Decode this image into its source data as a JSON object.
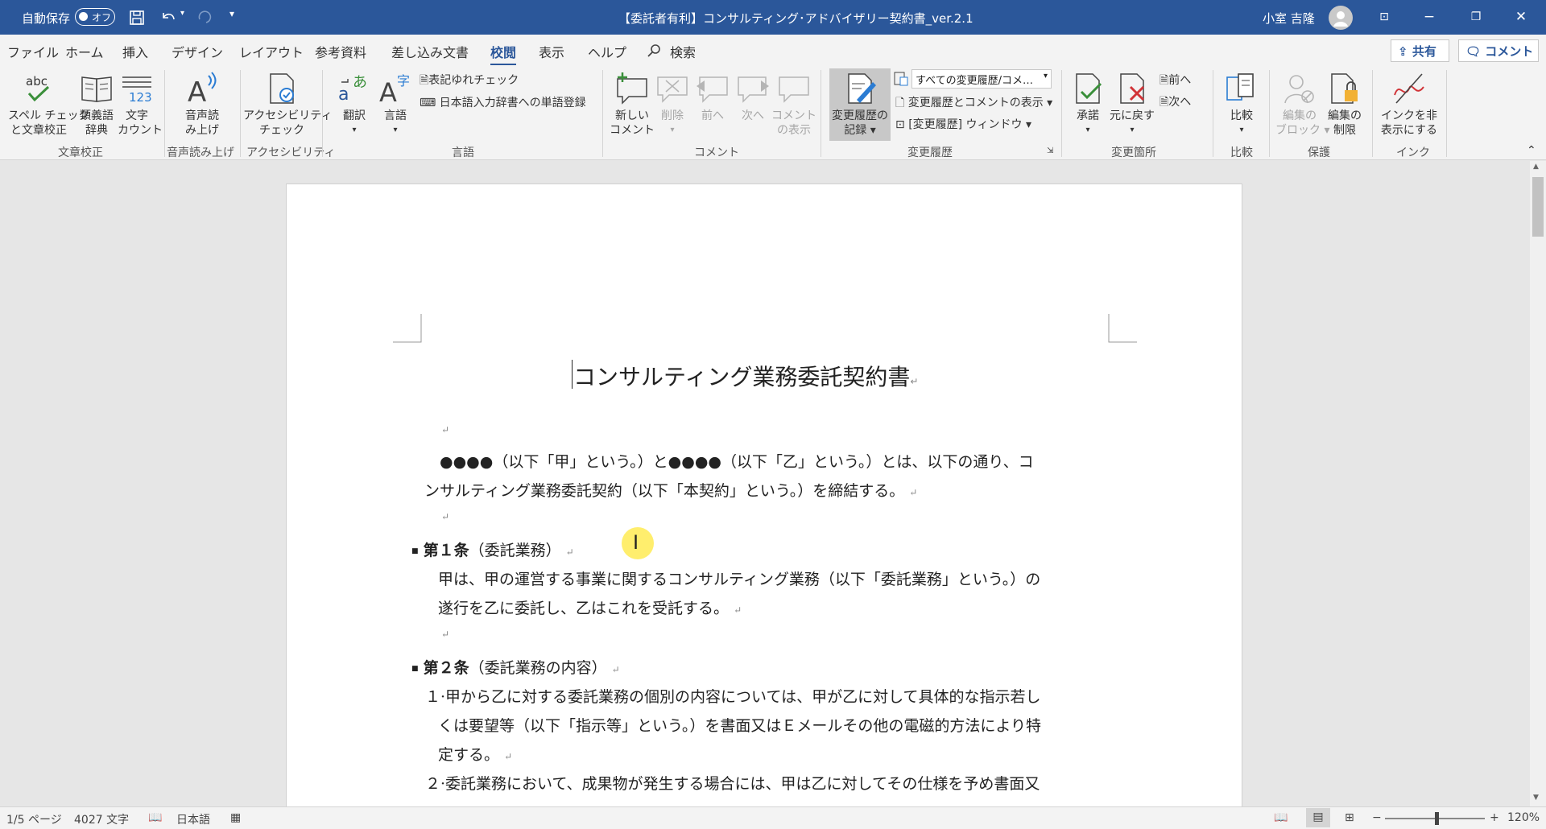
{
  "titlebar": {
    "autosave_label": "自動保存",
    "autosave_state": "オフ",
    "document_title": "【委託者有利】コンサルティング･アドバイザリー契約書_ver.2.1",
    "user_name": "小室 吉隆"
  },
  "menu": {
    "tabs": [
      "ファイル",
      "ホーム",
      "挿入",
      "デザイン",
      "レイアウト",
      "参考資料",
      "差し込み文書",
      "校閲",
      "表示",
      "ヘルプ"
    ],
    "active_tab": "校閲",
    "search_label": "検索",
    "share_label": "共有",
    "comment_label": "コメント"
  },
  "ribbon": {
    "proofing": {
      "spell_label1": "スペル チェック",
      "spell_label2": "と文章校正",
      "thesaurus_label1": "類義語",
      "thesaurus_label2": "辞典",
      "wordcount_label1": "文字",
      "wordcount_label2": "カウント",
      "group": "文章校正"
    },
    "speech": {
      "label1": "音声読",
      "label2": "み上げ",
      "group": "音声読み上げ"
    },
    "accessibility": {
      "label1": "アクセシビリティ",
      "label2": "チェック",
      "group": "アクセシビリティ"
    },
    "language": {
      "translate_label": "翻訳",
      "language_label": "言語",
      "spelling_variation_label": "表記ゆれチェック",
      "ime_dictionary_label": "日本語入力辞書への単語登録",
      "group": "言語"
    },
    "comments": {
      "new_label1": "新しい",
      "new_label2": "コメント",
      "delete_label": "削除",
      "prev_label": "前へ",
      "next_label": "次へ",
      "show_label1": "コメント",
      "show_label2": "の表示",
      "group": "コメント"
    },
    "tracking": {
      "track_label1": "変更履歴の",
      "track_label2": "記録",
      "markup_dropdown": "すべての変更履歴/コメ…",
      "show_markup_label": "変更履歴とコメントの表示",
      "pane_label": "[変更履歴] ウィンドウ",
      "group": "変更履歴"
    },
    "changes": {
      "accept_label": "承諾",
      "reject_label": "元に戻す",
      "prev_label": "前へ",
      "next_label": "次へ",
      "group": "変更箇所"
    },
    "compare": {
      "label": "比較",
      "group": "比較"
    },
    "protect": {
      "block_label1": "編集の",
      "block_label2": "ブロック",
      "restrict_label1": "編集の",
      "restrict_label2": "制限",
      "group": "保護"
    },
    "ink": {
      "label1": "インクを非",
      "label2": "表示にする",
      "group": "インク"
    }
  },
  "document": {
    "title": "コンサルティング業務委託契約書",
    "intro_line1": "●●●●（以下「甲」という。）と●●●●（以下「乙」という。）とは、以下の通り、コ",
    "intro_line2": "ンサルティング業務委託契約（以下「本契約」という。）を締結する。",
    "art1_heading": "第１条",
    "art1_title": "（委託業務）",
    "art1_line1": "甲は、甲の運営する事業に関するコンサルティング業務（以下「委託業務」という。）の",
    "art1_line2": "遂行を乙に委託し、乙はこれを受託する。",
    "art2_heading": "第２条",
    "art2_title": "（委託業務の内容）",
    "art2_p1_line1": "１·甲から乙に対する委託業務の個別の内容については、甲が乙に対して具体的な指示若し",
    "art2_p1_line2": "くは要望等（以下「指示等」という。）を書面又はＥメールその他の電磁的方法により特",
    "art2_p1_line3": "定する。",
    "art2_p2_line1": "２·委託業務において、成果物が発生する場合には、甲は乙に対してその仕様を予め書面又"
  },
  "statusbar": {
    "page": "1/5 ページ",
    "words": "4027 文字",
    "language": "日本語",
    "zoom": "120%"
  }
}
